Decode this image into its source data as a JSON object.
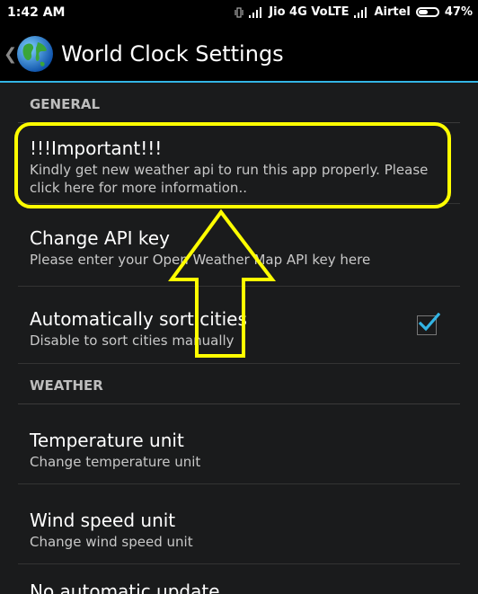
{
  "status_bar": {
    "time": "1:42 AM",
    "carrier1": "Jio 4G VoLTE",
    "carrier2": "Airtel",
    "battery": "47%"
  },
  "action_bar": {
    "back_glyph": "❮",
    "title": "World Clock Settings",
    "logo_icon": "globe-icon"
  },
  "sections": {
    "general": "GENERAL",
    "weather": "WEATHER"
  },
  "items": {
    "important": {
      "title": "!!!Important!!!",
      "summary": "Kindly get new weather api to run this app properly. Please click here for more information.."
    },
    "api_key": {
      "title": "Change API key",
      "summary": "Please enter your Open Weather Map API key here"
    },
    "sort": {
      "title": "Automatically sort cities",
      "summary": "Disable to sort cities manually",
      "checked": true
    },
    "temp": {
      "title": "Temperature unit",
      "summary": "Change temperature unit"
    },
    "wind": {
      "title": "Wind speed unit",
      "summary": "Change wind speed unit"
    },
    "auto_update": {
      "title": "No automatic update"
    }
  },
  "colors": {
    "accent": "#33b5e5",
    "annotation": "#ffff00",
    "checkmark": "#33b5e5"
  }
}
